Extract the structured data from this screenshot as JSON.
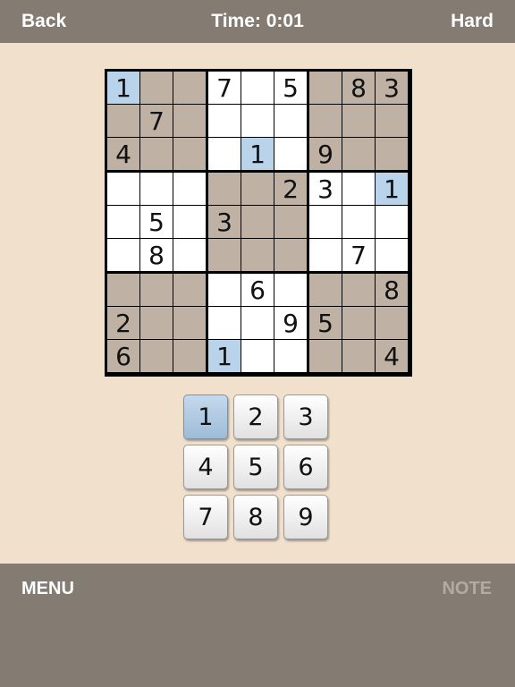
{
  "header": {
    "back_label": "Back",
    "timer_label": "Time: 0:01",
    "difficulty_label": "Hard"
  },
  "board": {
    "rows": [
      [
        "1",
        "",
        "",
        "7",
        "",
        "5",
        "",
        "8",
        "3"
      ],
      [
        "",
        "7",
        "",
        "",
        "",
        "",
        "",
        "",
        ""
      ],
      [
        "4",
        "",
        "",
        "",
        "1",
        "",
        "9",
        "",
        ""
      ],
      [
        "",
        "",
        "",
        "",
        "",
        "2",
        "3",
        "",
        "1"
      ],
      [
        "",
        "5",
        "",
        "3",
        "",
        "",
        "",
        "",
        ""
      ],
      [
        "",
        "8",
        "",
        "",
        "",
        "",
        "",
        "7",
        ""
      ],
      [
        "",
        "",
        "",
        "",
        "6",
        "",
        "",
        "",
        "8"
      ],
      [
        "2",
        "",
        "",
        "",
        "",
        "9",
        "5",
        "",
        ""
      ],
      [
        "6",
        "",
        "",
        "1",
        "",
        "",
        "",
        "",
        "4"
      ]
    ],
    "highlighted_digit": "1"
  },
  "numpad": {
    "keys": [
      "1",
      "2",
      "3",
      "4",
      "5",
      "6",
      "7",
      "8",
      "9"
    ],
    "selected": "1"
  },
  "footer": {
    "menu_label": "MENU",
    "note_label": "NOTE"
  },
  "colors": {
    "background": "#f1e1cc",
    "bar": "#847b72",
    "box_white": "#ffffff",
    "box_tan": "#bfb2a4",
    "highlight": "#b9d3ea"
  }
}
